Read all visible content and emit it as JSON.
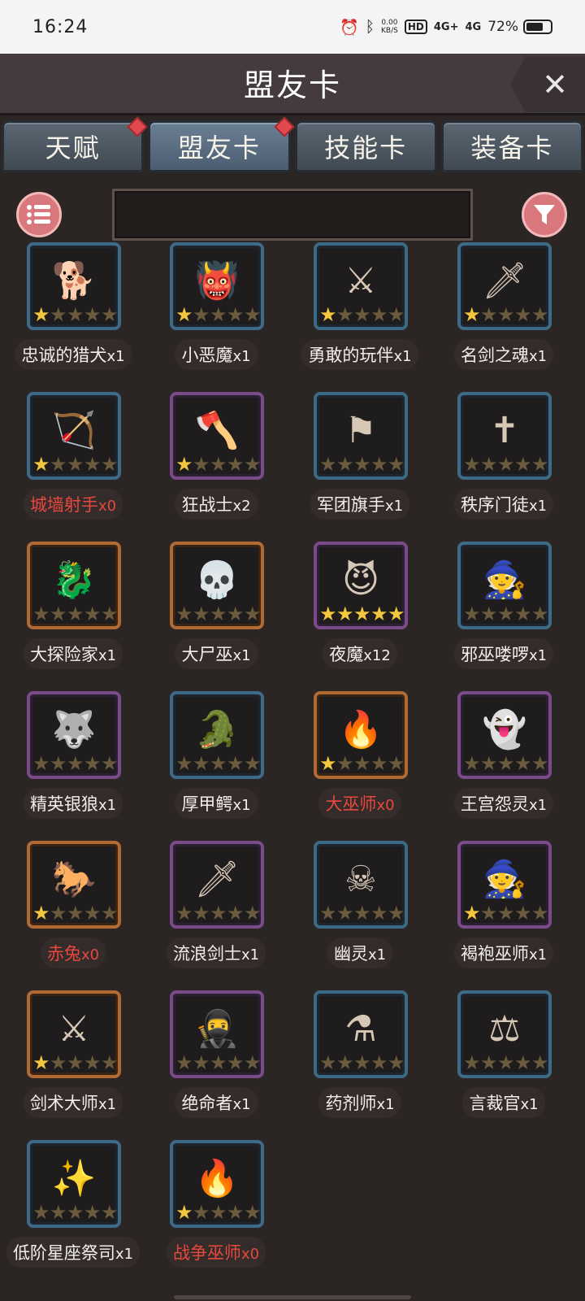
{
  "status_bar": {
    "time": "16:24",
    "net_speed": "0.00",
    "net_unit": "KB/S",
    "hd": "HD",
    "sig1": "4G+",
    "sig2": "4G",
    "battery": "72%",
    "battery_level": 0.72
  },
  "header": {
    "title": "盟友卡",
    "close": "✕"
  },
  "tabs": [
    {
      "label": "天赋",
      "dot": true
    },
    {
      "label": "盟友卡",
      "dot": true,
      "active": true
    },
    {
      "label": "技能卡",
      "dot": false
    },
    {
      "label": "装备卡",
      "dot": false
    }
  ],
  "search": {
    "placeholder": ""
  },
  "cards": [
    {
      "name": "忠诚的猎犬",
      "count": "x1",
      "stars": 1,
      "frame": "blue",
      "icon": "hound-icon",
      "glyph": "🐕",
      "zero": false
    },
    {
      "name": "小恶魔",
      "count": "x1",
      "stars": 1,
      "frame": "blue",
      "icon": "imp-icon",
      "glyph": "👹",
      "zero": false
    },
    {
      "name": "勇敢的玩伴",
      "count": "x1",
      "stars": 1,
      "frame": "blue",
      "icon": "knight-icon",
      "glyph": "⚔",
      "zero": false
    },
    {
      "name": "名剑之魂",
      "count": "x1",
      "stars": 1,
      "frame": "blue",
      "icon": "sword-spirit-icon",
      "glyph": "🗡",
      "zero": false
    },
    {
      "name": "城墙射手",
      "count": "x0",
      "stars": 1,
      "frame": "blue",
      "icon": "archer-icon",
      "glyph": "🏹",
      "zero": true
    },
    {
      "name": "狂战士",
      "count": "x2",
      "stars": 1,
      "frame": "purple",
      "icon": "berserker-icon",
      "glyph": "🪓",
      "zero": false
    },
    {
      "name": "军团旗手",
      "count": "x1",
      "stars": 0,
      "frame": "blue",
      "icon": "flag-bearer-icon",
      "glyph": "⚑",
      "zero": false
    },
    {
      "name": "秩序门徒",
      "count": "x1",
      "stars": 0,
      "frame": "blue",
      "icon": "disciple-icon",
      "glyph": "✝",
      "zero": false
    },
    {
      "name": "大探险家",
      "count": "x1",
      "stars": 0,
      "frame": "orange",
      "icon": "dragon-icon",
      "glyph": "🐉",
      "zero": false
    },
    {
      "name": "大尸巫",
      "count": "x1",
      "stars": 0,
      "frame": "orange",
      "icon": "lich-icon",
      "glyph": "💀",
      "zero": false
    },
    {
      "name": "夜魔",
      "count": "x12",
      "stars": 5,
      "frame": "purple",
      "icon": "night-demon-icon",
      "glyph": "😈",
      "zero": false
    },
    {
      "name": "邪巫喽啰",
      "count": "x1",
      "stars": 0,
      "frame": "blue",
      "icon": "witch-icon",
      "glyph": "🧙",
      "zero": false
    },
    {
      "name": "精英银狼",
      "count": "x1",
      "stars": 0,
      "frame": "purple",
      "icon": "wolf-icon",
      "glyph": "🐺",
      "zero": false
    },
    {
      "name": "厚甲鳄",
      "count": "x1",
      "stars": 0,
      "frame": "blue",
      "icon": "crocodile-icon",
      "glyph": "🐊",
      "zero": false
    },
    {
      "name": "大巫师",
      "count": "x0",
      "stars": 1,
      "frame": "orange",
      "icon": "wizard-icon",
      "glyph": "🔥",
      "zero": true
    },
    {
      "name": "王宫怨灵",
      "count": "x1",
      "stars": 0,
      "frame": "purple",
      "icon": "ghost-icon",
      "glyph": "👻",
      "zero": false
    },
    {
      "name": "赤兔",
      "count": "x0",
      "stars": 1,
      "frame": "orange",
      "icon": "horse-icon",
      "glyph": "🐎",
      "zero": true
    },
    {
      "name": "流浪剑士",
      "count": "x1",
      "stars": 0,
      "frame": "purple",
      "icon": "swordsman-icon",
      "glyph": "🗡",
      "zero": false
    },
    {
      "name": "幽灵",
      "count": "x1",
      "stars": 0,
      "frame": "blue",
      "icon": "spirit-icon",
      "glyph": "☠",
      "zero": false
    },
    {
      "name": "褐袍巫师",
      "count": "x1",
      "stars": 1,
      "frame": "purple",
      "icon": "brown-mage-icon",
      "glyph": "🧙",
      "zero": false
    },
    {
      "name": "剑术大师",
      "count": "x1",
      "stars": 1,
      "frame": "orange",
      "icon": "sword-master-icon",
      "glyph": "⚔",
      "zero": false
    },
    {
      "name": "绝命者",
      "count": "x1",
      "stars": 0,
      "frame": "purple",
      "icon": "assassin-icon",
      "glyph": "🥷",
      "zero": false
    },
    {
      "name": "药剂师",
      "count": "x1",
      "stars": 0,
      "frame": "blue",
      "icon": "alchemist-icon",
      "glyph": "⚗",
      "zero": false
    },
    {
      "name": "言裁官",
      "count": "x1",
      "stars": 0,
      "frame": "blue",
      "icon": "judge-icon",
      "glyph": "⚖",
      "zero": false
    },
    {
      "name": "低阶星座祭司",
      "count": "x1",
      "stars": 0,
      "frame": "blue",
      "icon": "priest-icon",
      "glyph": "✨",
      "zero": false
    },
    {
      "name": "战争巫师",
      "count": "x0",
      "stars": 1,
      "frame": "blue",
      "icon": "war-mage-icon",
      "glyph": "🔥",
      "zero": true
    }
  ]
}
